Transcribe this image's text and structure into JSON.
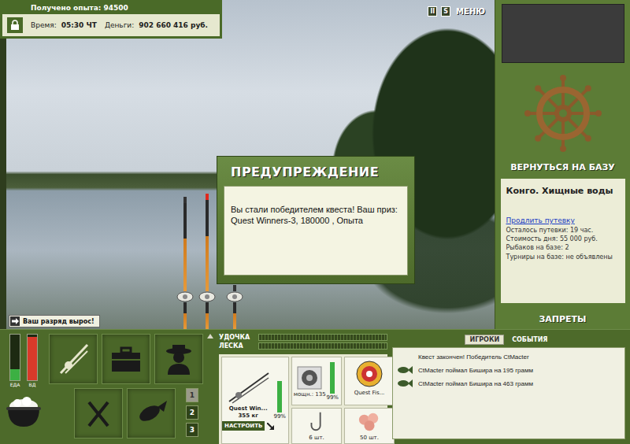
{
  "hud": {
    "experience": "Получено опыта: 94500",
    "time_label": "Время:",
    "time": "05:30 ЧТ",
    "money_label": "Деньги:",
    "money": "902 660 416 руб."
  },
  "top_menu": [
    {
      "label": "II",
      "kind": "key"
    },
    {
      "label": "S",
      "kind": "key"
    },
    {
      "label": "МЕНЮ",
      "kind": "text"
    }
  ],
  "dialog": {
    "title": "ПРЕДУПРЕЖДЕНИЕ",
    "message": "Вы стали победителем квеста! Ваш приз: Quest Winners-3, 180000 , Опыта"
  },
  "rank_notice": {
    "text": "Ваш разряд вырос!"
  },
  "rods_in_water": [
    {
      "bite": false
    },
    {
      "bite": true
    },
    {
      "bite": false
    }
  ],
  "side": {
    "base_button": "ВЕРНУТЬСЯ НА БАЗУ",
    "location": "Конго. Хищные воды",
    "extend_link": "Продлить путевку",
    "info": [
      "Осталось путевки: 19 час.",
      "Стоимость дня: 55 000 руб.",
      "Рыбаков на базе: 2",
      "Турниры на базе: не объявлены"
    ],
    "bans": "ЗАПРЕТЫ"
  },
  "needs": [
    {
      "label": "ЕДА",
      "level": 0.25,
      "color": "#3cb043"
    },
    {
      "label": "ВД",
      "level": 0.95,
      "color": "#d83a2a"
    }
  ],
  "slots": [
    {
      "label": "1",
      "selected": true
    },
    {
      "label": "2",
      "selected": false
    },
    {
      "label": "3",
      "selected": false
    }
  ],
  "tension": [
    {
      "label": "УДОЧКА",
      "level": 0
    },
    {
      "label": "ЛЕСКА",
      "level": 0
    }
  ],
  "tackle": {
    "rod": {
      "name": "Quest Win...",
      "weight": "355 кг",
      "wear": "99%",
      "level": 0.99
    },
    "setup_button": "НАСТРОИТЬ",
    "reel": {
      "power": "мощн.: 135",
      "wear": "99%",
      "level": 0.99
    },
    "line": {
      "name": "Quest Fis..."
    },
    "hook": {
      "count": "6 шт."
    },
    "bait": {
      "count": "50 шт."
    }
  },
  "chat": {
    "tabs": [
      {
        "label": "ИГРОКИ",
        "selected": true
      },
      {
        "label": "СОБЫТИЯ",
        "selected": false
      }
    ],
    "messages": [
      {
        "text": "Квест закончен! Победитель CtMacter",
        "fish": false
      },
      {
        "text": "CtMacter поймал Бишира на 195 грамм",
        "fish": true
      },
      {
        "text": "CtMacter поймал Бишира на 463 грамм",
        "fish": true
      }
    ]
  }
}
